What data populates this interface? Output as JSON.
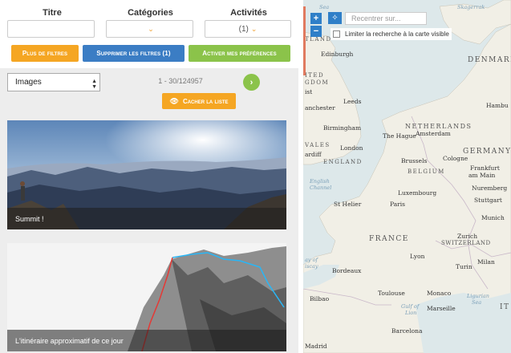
{
  "filters": {
    "headers": {
      "title": "Titre",
      "categories": "Catégories",
      "activities": "Activités"
    },
    "activities_value": "(1)"
  },
  "buttons": {
    "more_filters": "Plus de filtres",
    "clear_filters": "Supprimer les filtres (1)",
    "activate_prefs": "Activer mes préférences",
    "hide_list": "Cacher la liste"
  },
  "list": {
    "type_select": "Images",
    "count": "1 - 30/124957",
    "items": [
      {
        "caption": "Summit !"
      },
      {
        "caption": "L'itinéraire approximatif de ce jour"
      }
    ]
  },
  "map": {
    "zoom_in": "+",
    "zoom_out": "−",
    "recenter_placeholder": "Recentrer sur...",
    "limit_label": "Limiter la recherche à la carte visible",
    "labels": {
      "sea_top": "Sea",
      "skagerrak": "Skagerrak",
      "denmark": "DENMARK",
      "tland": "TLAND",
      "edinburgh": "Edinburgh",
      "ited": "ITED",
      "gdom": "GDOM",
      "ist": "ist",
      "leeds": "Leeds",
      "manchester": "anchester",
      "hamburg": "Hambu",
      "birmingham": "Birmingham",
      "netherlands": "NETHERLANDS",
      "amsterdam": "Amsterdam",
      "thehague": "The Hague",
      "wales": "VALES",
      "london": "London",
      "cardiff": "ardiff",
      "germany": "GERMANY",
      "england": "ENGLAND",
      "brussels": "Brussels",
      "cologne": "Cologne",
      "belgium": "BELGIUM",
      "frankfurt": "Frankfurt",
      "ammain": "am Main",
      "nuremberg": "Nuremberg",
      "english": "English",
      "channel": "Channel",
      "luxembourg": "Luxembourg",
      "stuttgart": "Stuttgart",
      "sthelier": "St Helier",
      "paris": "Paris",
      "munich": "Munich",
      "france": "FRANCE",
      "zurich": "Zurich",
      "switzerland": "SWITZERLAND",
      "bayof": "ay of",
      "biscay": "iscay",
      "lyon": "Lyon",
      "milan": "Milan",
      "turin": "Turin",
      "bordeaux": "Bordeaux",
      "toulouse": "Toulouse",
      "monaco": "Monaco",
      "ligurian": "Ligurian",
      "ligsea": "Sea",
      "gulfof": "Gulf of",
      "lion": "Lion",
      "marseille": "Marseille",
      "it": "IT",
      "bilbao": "Bilbao",
      "barcelona": "Barcelona",
      "madrid": "Madrid"
    }
  },
  "colors": {
    "orange": "#f5a623",
    "blue": "#3b7dc4",
    "green": "#8bc34a",
    "map_water": "#dde8ea",
    "map_land": "#f1efe6"
  }
}
